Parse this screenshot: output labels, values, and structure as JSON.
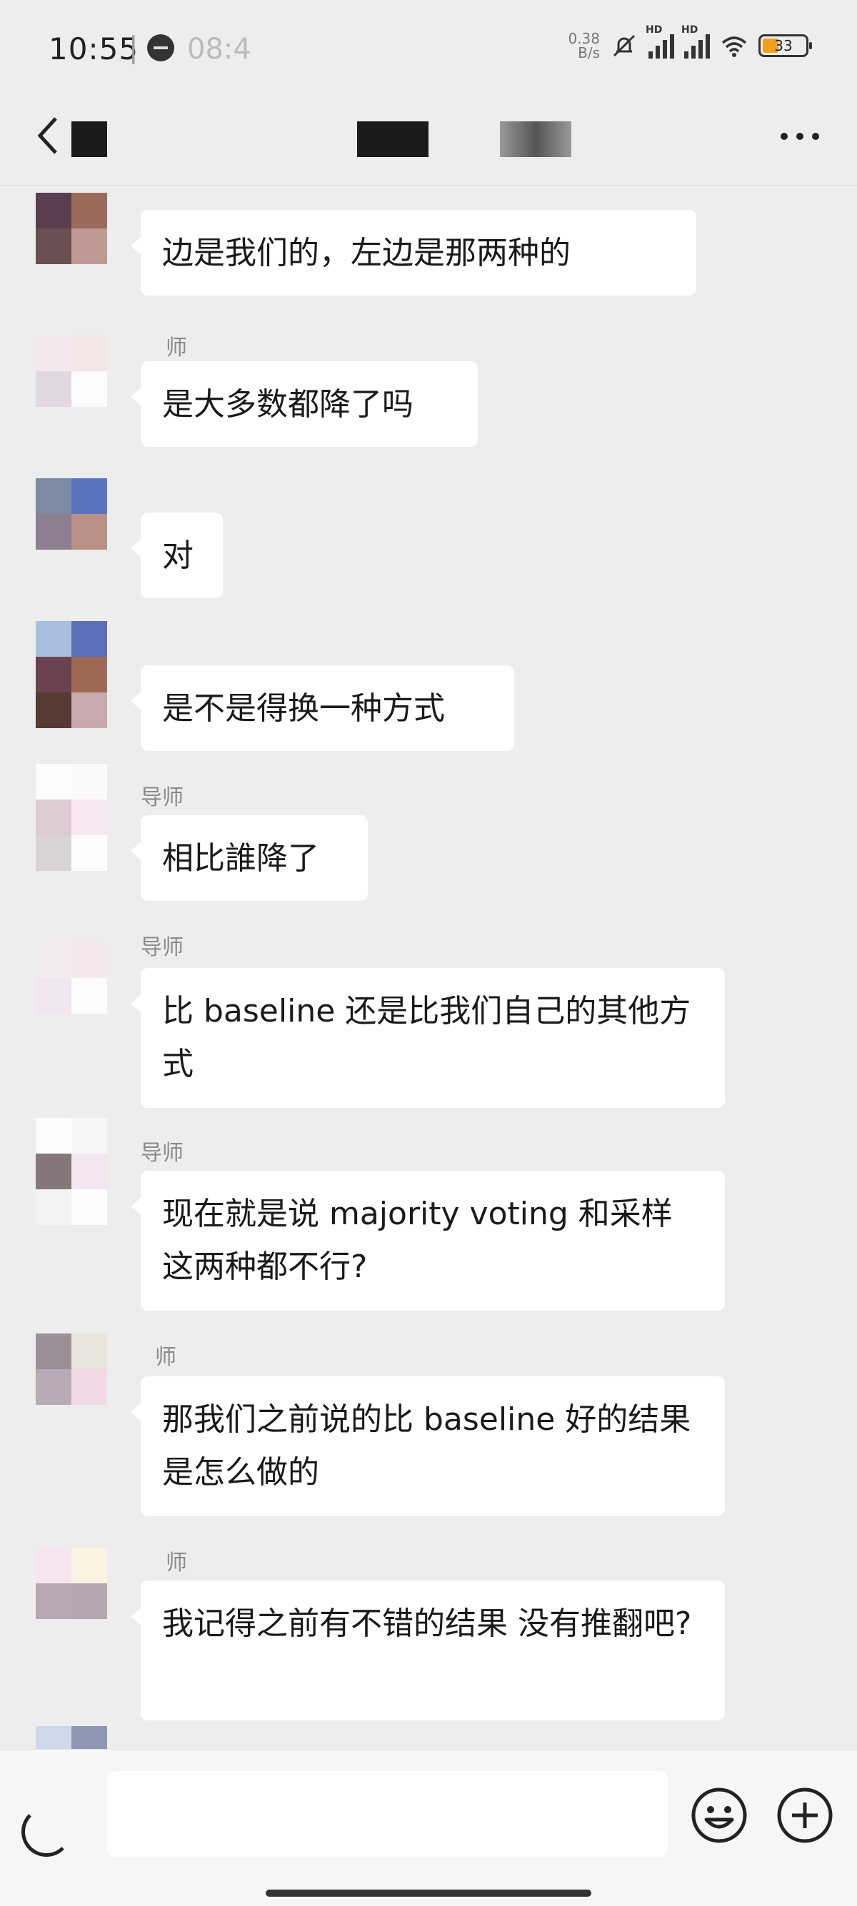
{
  "status_bar": {
    "time": "10:55",
    "separator": "|",
    "extra": "08:4",
    "speed_value": "0.38",
    "speed_unit": "B/s",
    "signal1_label": "HD",
    "signal2_label": "HD",
    "battery": "33",
    "icons": [
      "clock-icon",
      "mute-bell-icon",
      "signal-icon",
      "signal-icon",
      "wifi-icon",
      "battery-icon"
    ]
  },
  "nav": {
    "icons": [
      "back-icon",
      "more-icon"
    ]
  },
  "messages": [
    {
      "sender": "",
      "text": "边是我们的，左边是那两种的"
    },
    {
      "sender": "师",
      "text": "是大多数都降了吗"
    },
    {
      "sender": "",
      "text": "对"
    },
    {
      "sender": "",
      "text": "是不是得换一种方式"
    },
    {
      "sender": "导师",
      "text": "相比誰降了"
    },
    {
      "sender": "导师",
      "text": "比 baseline 还是比我们自己的其他方式"
    },
    {
      "sender": "导师",
      "text": "现在就是说 majority voting 和采样这两种都不行?"
    },
    {
      "sender": "师",
      "text": "那我们之前说的比 baseline 好的结果是怎么做的"
    },
    {
      "sender": "师",
      "text": "我记得之前有不错的结果 没有推翻吧?"
    }
  ],
  "input_bar": {
    "icons": [
      "voice-icon",
      "emoji-icon",
      "plus-icon"
    ]
  },
  "colors": {
    "background": "#ededed",
    "bubble": "#ffffff",
    "sender_text": "#8a8a8a",
    "battery_fill": "#f0a020"
  }
}
